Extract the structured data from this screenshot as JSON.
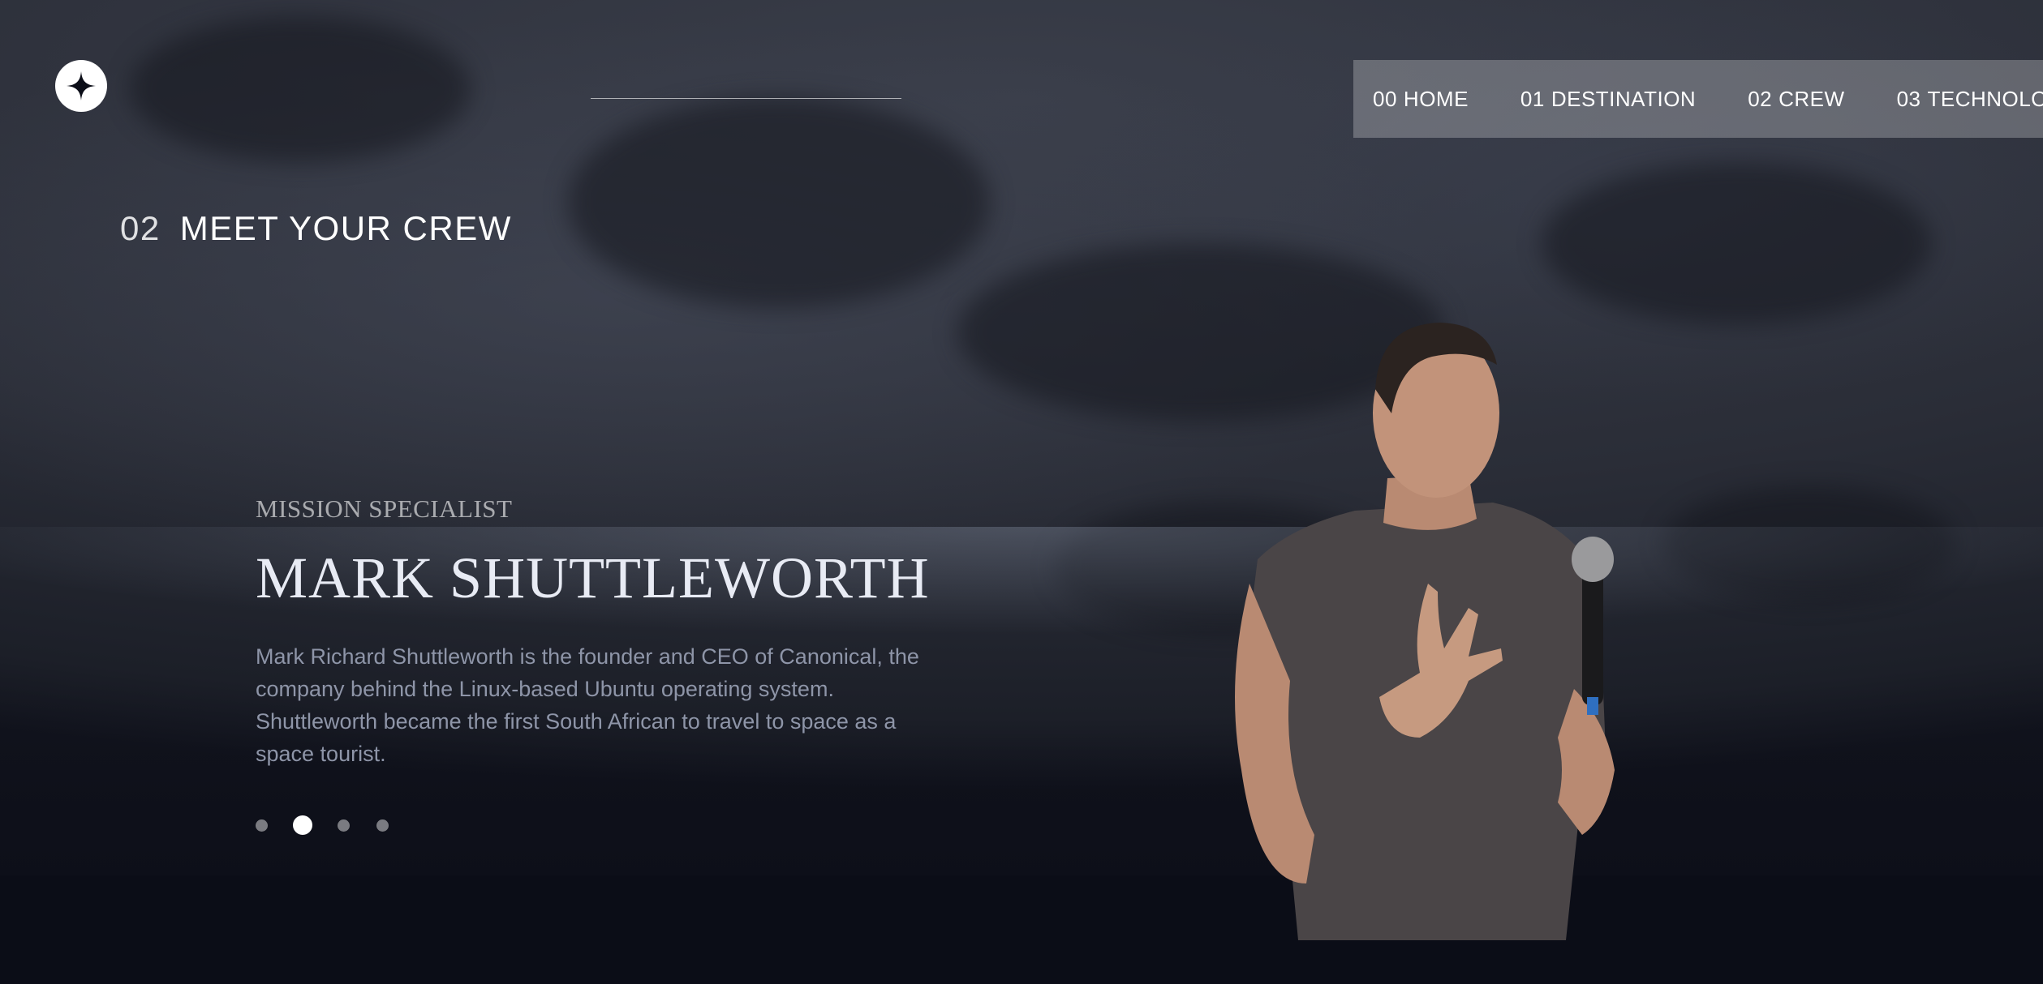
{
  "nav": {
    "items": [
      {
        "num": "00",
        "label": "HOME"
      },
      {
        "num": "01",
        "label": "DESTINATION"
      },
      {
        "num": "02",
        "label": "CREW"
      },
      {
        "num": "03",
        "label": "TECHNOLOGY"
      }
    ]
  },
  "header": {
    "logo_icon": "star-logo-icon"
  },
  "section": {
    "number": "02",
    "title": "MEET YOUR CREW"
  },
  "crew": {
    "role": "MISSION SPECIALIST",
    "name": "MARK SHUTTLEWORTH",
    "bio": "Mark Richard Shuttleworth is the founder and CEO of Canonical, the company behind the Linux-based Ubuntu operating system. Shuttleworth became the first South African to travel to space as a space tourist.",
    "slides_total": 4,
    "active_slide": 2
  },
  "colors": {
    "background": "#0b0d17",
    "nav_bg": "rgba(255,255,255,0.25)",
    "role_text": "#9aa0b0",
    "bio_text": "#8e95a8"
  }
}
